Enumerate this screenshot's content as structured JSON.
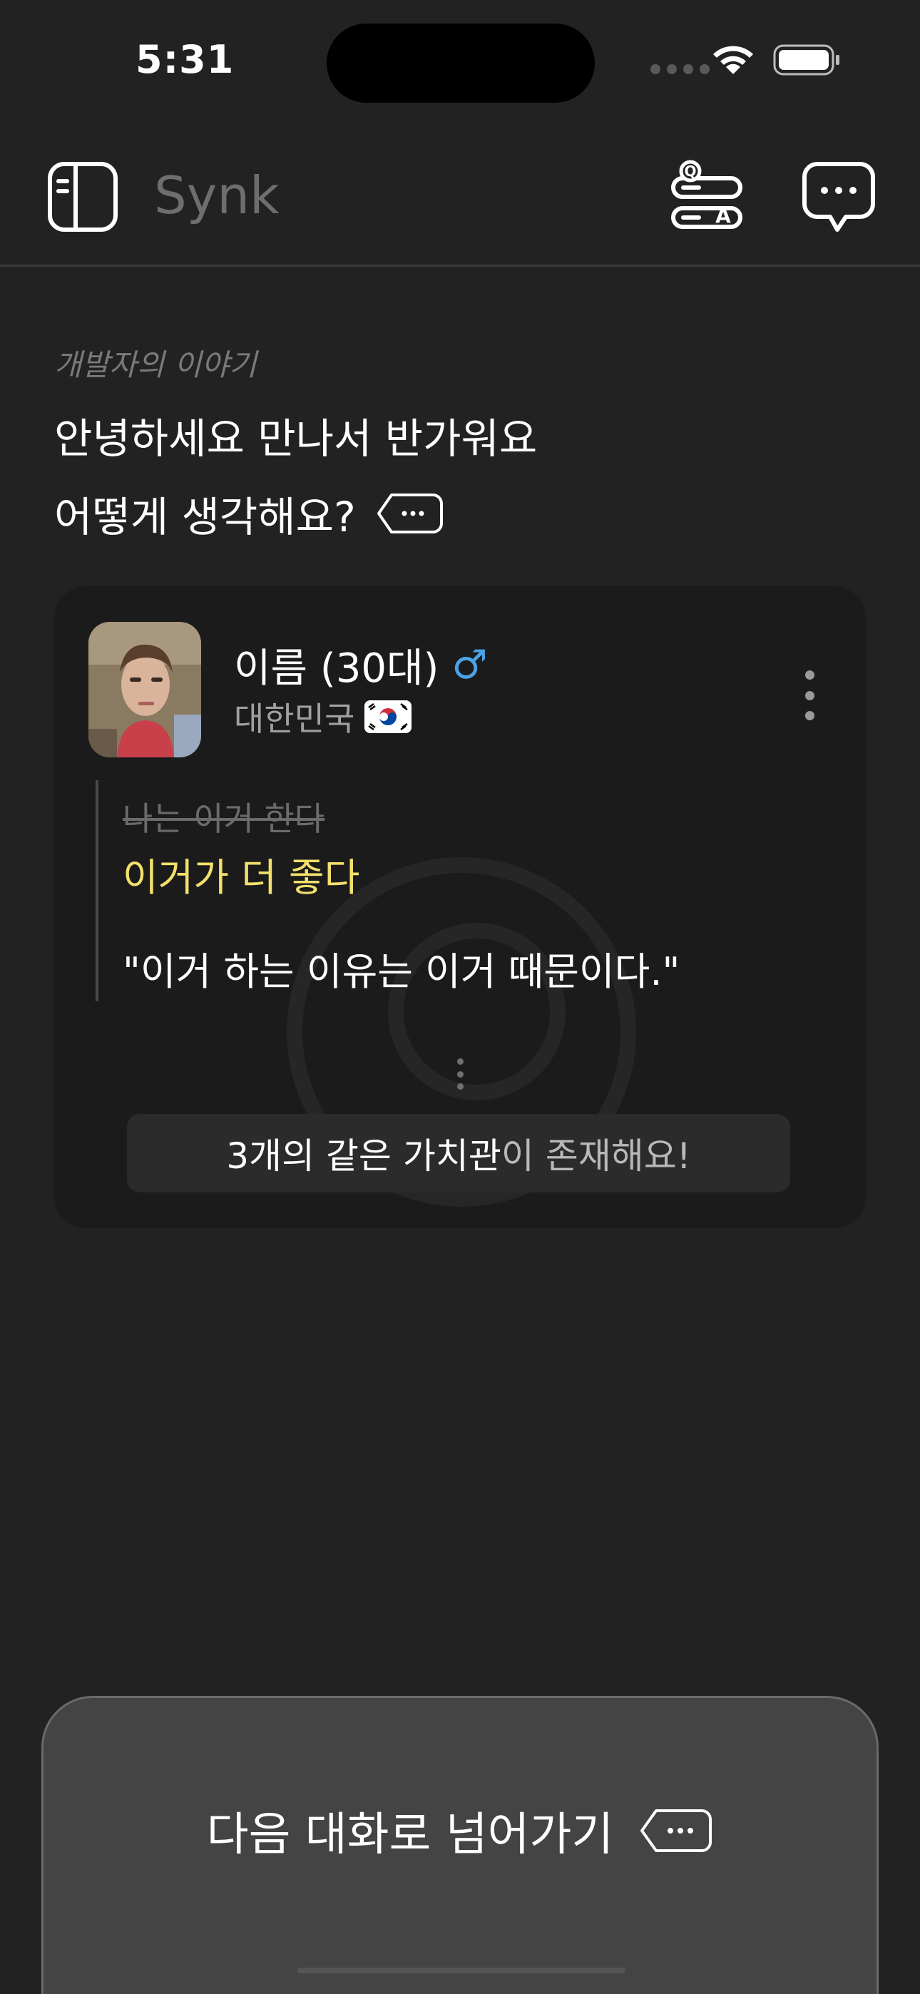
{
  "status_bar": {
    "time": "5:31"
  },
  "header": {
    "app_title": "Synk"
  },
  "story": {
    "label": "개발자의 이야기",
    "greeting": "안녕하세요 만나서 반가워요",
    "question": "어떻게 생각해요?"
  },
  "card": {
    "name": "이름 (30대)",
    "gender_symbol": "♂",
    "country": "대한민국",
    "old_answer": "나는 이거 한다",
    "new_answer": "이거가 더 좋다",
    "reason": "\"이거 하는 이유는 이거 때문이다.\"",
    "shared_values_count": "3개의 같은 가치관",
    "shared_values_suffix": "이 존재해요!"
  },
  "bottom_sheet": {
    "next_label": "다음 대화로 넘어가기"
  },
  "colors": {
    "background": "#222222",
    "card": "#1b1b1b",
    "highlight": "#f2e06b",
    "gender_male": "#4aa3e8"
  },
  "icons": [
    "sidebar-toggle-icon",
    "qa-icon",
    "chat-icon",
    "speech-bubble-icon",
    "more-vertical-icon",
    "korea-flag-icon"
  ]
}
